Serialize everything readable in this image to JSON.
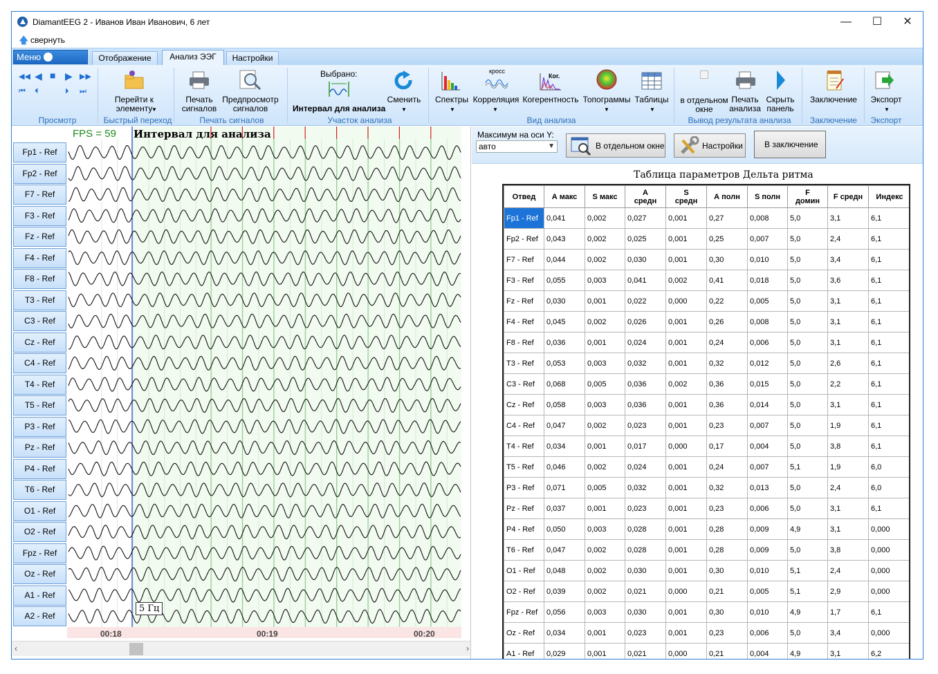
{
  "window": {
    "title": "DiamantEEG 2 - Иванов  Иван Иванович, 6 лет",
    "controls": [
      "—",
      "☐",
      "✕"
    ]
  },
  "collapse_label": "свернуть",
  "menu_label": "Меню",
  "tabs": [
    {
      "label": "Отображение",
      "active": false
    },
    {
      "label": "Анализ ЭЭГ",
      "active": true
    },
    {
      "label": "Настройки",
      "active": false
    }
  ],
  "ribbon": {
    "groups": {
      "view": "Просмотр",
      "quick_jump": "Быстрый переход",
      "print": "Печать сигналов",
      "segment": "Участок анализа",
      "analysis_type": "Вид анализа",
      "output": "Вывод результата анализа",
      "conclusion": "Заключение",
      "export": "Экспорт"
    },
    "buttons": {
      "goto_line1": "Перейти к",
      "goto_line2": "элементу",
      "print_line1": "Печать",
      "print_line2": "сигналов",
      "preview_line1": "Предпросмотр",
      "preview_line2": "сигналов",
      "selected": "Выбрано:",
      "selected_value": "Интервал для анализа",
      "change": "Сменить",
      "spectra": "Спектры",
      "correlation": "Корреляция",
      "coherence": "Когерентность",
      "topograms": "Топограммы",
      "tables": "Таблицы",
      "sep_window_line1": "в отдельном",
      "sep_window_line2": "окне",
      "print_analysis_line1": "Печать",
      "print_analysis_line2": "анализа",
      "hide_panel_line1": "Скрыть",
      "hide_panel_line2": "панель",
      "conclusion": "Заключение",
      "export": "Экспорт",
      "icon_cross": "кросс",
      "icon_kog": "Ког."
    }
  },
  "eeg": {
    "fps": "FPS = 59",
    "interval_title": "Интервал для анализа",
    "frequency": "5 Гц",
    "time_labels": [
      "00:18",
      "00:19",
      "00:20"
    ],
    "channels": [
      "Fp1 - Ref",
      "Fp2 - Ref",
      "F7 - Ref",
      "F3 - Ref",
      "Fz - Ref",
      "F4 - Ref",
      "F8 - Ref",
      "T3 - Ref",
      "C3 - Ref",
      "Cz - Ref",
      "C4 - Ref",
      "T4 - Ref",
      "T5 - Ref",
      "P3 - Ref",
      "Pz - Ref",
      "P4 - Ref",
      "T6 - Ref",
      "O1 - Ref",
      "O2 - Ref",
      "Fpz - Ref",
      "Oz - Ref",
      "A1 - Ref",
      "A2 - Ref"
    ]
  },
  "right_panel": {
    "ymax_label": "Максимум на оси Y:",
    "ymax_value": "авто",
    "btn_separate": "В отдельном окне",
    "btn_settings": "Настройки",
    "btn_conclusion": "В заключение",
    "table_title": "Таблица параметров Дельта ритма"
  },
  "table": {
    "headers": [
      [
        "Отвед",
        ""
      ],
      [
        "А макс",
        ""
      ],
      [
        "S макс",
        ""
      ],
      [
        "А",
        "средн"
      ],
      [
        "S",
        "средн"
      ],
      [
        "А полн",
        ""
      ],
      [
        "S полн",
        ""
      ],
      [
        "F",
        "домин"
      ],
      [
        "F средн",
        ""
      ],
      [
        "Индекс",
        ""
      ]
    ],
    "rows": [
      [
        "Fp1 - Ref",
        "0,041",
        "0,002",
        "0,027",
        "0,001",
        "0,27",
        "0,008",
        "5,0",
        "3,1",
        "6,1"
      ],
      [
        "Fp2 - Ref",
        "0,043",
        "0,002",
        "0,025",
        "0,001",
        "0,25",
        "0,007",
        "5,0",
        "2,4",
        "6,1"
      ],
      [
        "F7 - Ref",
        "0,044",
        "0,002",
        "0,030",
        "0,001",
        "0,30",
        "0,010",
        "5,0",
        "3,4",
        "6,1"
      ],
      [
        "F3 - Ref",
        "0,055",
        "0,003",
        "0,041",
        "0,002",
        "0,41",
        "0,018",
        "5,0",
        "3,6",
        "6,1"
      ],
      [
        "Fz - Ref",
        "0,030",
        "0,001",
        "0,022",
        "0,000",
        "0,22",
        "0,005",
        "5,0",
        "3,1",
        "6,1"
      ],
      [
        "F4 - Ref",
        "0,045",
        "0,002",
        "0,026",
        "0,001",
        "0,26",
        "0,008",
        "5,0",
        "3,1",
        "6,1"
      ],
      [
        "F8 - Ref",
        "0,036",
        "0,001",
        "0,024",
        "0,001",
        "0,24",
        "0,006",
        "5,0",
        "3,1",
        "6,1"
      ],
      [
        "T3 - Ref",
        "0,053",
        "0,003",
        "0,032",
        "0,001",
        "0,32",
        "0,012",
        "5,0",
        "2,6",
        "6,1"
      ],
      [
        "C3 - Ref",
        "0,068",
        "0,005",
        "0,036",
        "0,002",
        "0,36",
        "0,015",
        "5,0",
        "2,2",
        "6,1"
      ],
      [
        "Cz - Ref",
        "0,058",
        "0,003",
        "0,036",
        "0,001",
        "0,36",
        "0,014",
        "5,0",
        "3,1",
        "6,1"
      ],
      [
        "C4 - Ref",
        "0,047",
        "0,002",
        "0,023",
        "0,001",
        "0,23",
        "0,007",
        "5,0",
        "1,9",
        "6,1"
      ],
      [
        "T4 - Ref",
        "0,034",
        "0,001",
        "0,017",
        "0,000",
        "0,17",
        "0,004",
        "5,0",
        "3,8",
        "6,1"
      ],
      [
        "T5 - Ref",
        "0,046",
        "0,002",
        "0,024",
        "0,001",
        "0,24",
        "0,007",
        "5,1",
        "1,9",
        "6,0"
      ],
      [
        "P3 - Ref",
        "0,071",
        "0,005",
        "0,032",
        "0,001",
        "0,32",
        "0,013",
        "5,0",
        "2,4",
        "6,0"
      ],
      [
        "Pz - Ref",
        "0,037",
        "0,001",
        "0,023",
        "0,001",
        "0,23",
        "0,006",
        "5,0",
        "3,1",
        "6,1"
      ],
      [
        "P4 - Ref",
        "0,050",
        "0,003",
        "0,028",
        "0,001",
        "0,28",
        "0,009",
        "4,9",
        "3,1",
        "0,000"
      ],
      [
        "T6 - Ref",
        "0,047",
        "0,002",
        "0,028",
        "0,001",
        "0,28",
        "0,009",
        "5,0",
        "3,8",
        "0,000"
      ],
      [
        "O1 - Ref",
        "0,048",
        "0,002",
        "0,030",
        "0,001",
        "0,30",
        "0,010",
        "5,1",
        "2,4",
        "0,000"
      ],
      [
        "O2 - Ref",
        "0,039",
        "0,002",
        "0,021",
        "0,000",
        "0,21",
        "0,005",
        "5,1",
        "2,9",
        "0,000"
      ],
      [
        "Fpz - Ref",
        "0,056",
        "0,003",
        "0,030",
        "0,001",
        "0,30",
        "0,010",
        "4,9",
        "1,7",
        "6,1"
      ],
      [
        "Oz - Ref",
        "0,034",
        "0,001",
        "0,023",
        "0,001",
        "0,23",
        "0,006",
        "5,0",
        "3,4",
        "0,000"
      ],
      [
        "A1 - Ref",
        "0,029",
        "0,001",
        "0,021",
        "0,000",
        "0,21",
        "0,004",
        "4,9",
        "3,1",
        "6,2"
      ]
    ],
    "selected_row": 0
  },
  "colors": {
    "accent": "#2b7fd6",
    "selection": "#1c74d8",
    "interval_fill": "#f2fbf0",
    "grid_green": "#3aa83a",
    "marker_red": "#d21f1f",
    "cursor_blue": "#1a3fd0",
    "time_strip": "#fbe4e4"
  }
}
